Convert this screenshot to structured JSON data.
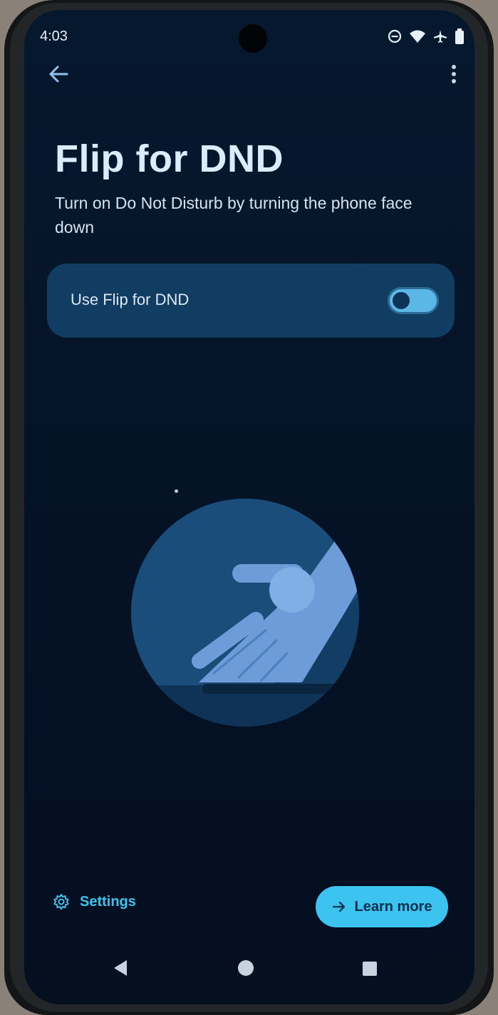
{
  "status_bar": {
    "time": "4:03",
    "icons": [
      "do-not-disturb-icon",
      "wifi-icon",
      "airplane-icon",
      "battery-icon"
    ]
  },
  "toolbar": {
    "back_icon": "arrow-back-icon",
    "more_icon": "more-vert-icon"
  },
  "page": {
    "title": "Flip for DND",
    "subtitle": "Turn on Do Not Disturb by turning the phone face down"
  },
  "toggle": {
    "label": "Use Flip for DND",
    "state": "off"
  },
  "footer": {
    "settings_label": "Settings",
    "settings_icon": "gear-icon",
    "learn_more_label": "Learn more",
    "learn_more_icon": "arrow-forward-icon"
  },
  "nav_bar": {
    "buttons": [
      "back-triangle-icon",
      "home-circle-icon",
      "recents-square-icon"
    ]
  },
  "colors": {
    "background": "#051327",
    "card": "#123d63",
    "accent": "#3cc3ef",
    "title": "#dcecff"
  }
}
